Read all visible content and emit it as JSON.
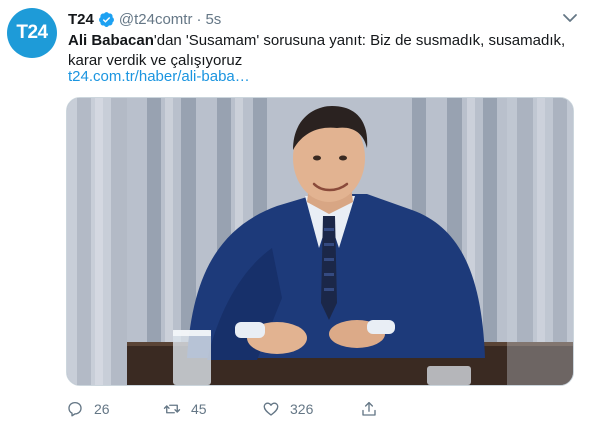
{
  "tweet": {
    "author_name": "T24",
    "avatar_text": "T24",
    "handle": "@t24comtr",
    "separator": "·",
    "time": "5s",
    "text_bold": "Ali Babacan",
    "text_rest": "'dan 'Susamam' sorusuna yanıt: Biz de susmadık, susamadık, karar verdik ve çalışıyoruz",
    "link": "t24.com.tr/haber/ali-baba…"
  },
  "actions": {
    "replies": "26",
    "retweets": "45",
    "likes": "326"
  },
  "colors": {
    "brand": "#1e9bd8",
    "link": "#1b95e0",
    "muted": "#657786"
  },
  "icons": [
    "verified-badge-icon",
    "chevron-down-icon",
    "reply-icon",
    "retweet-icon",
    "like-icon",
    "share-icon"
  ]
}
